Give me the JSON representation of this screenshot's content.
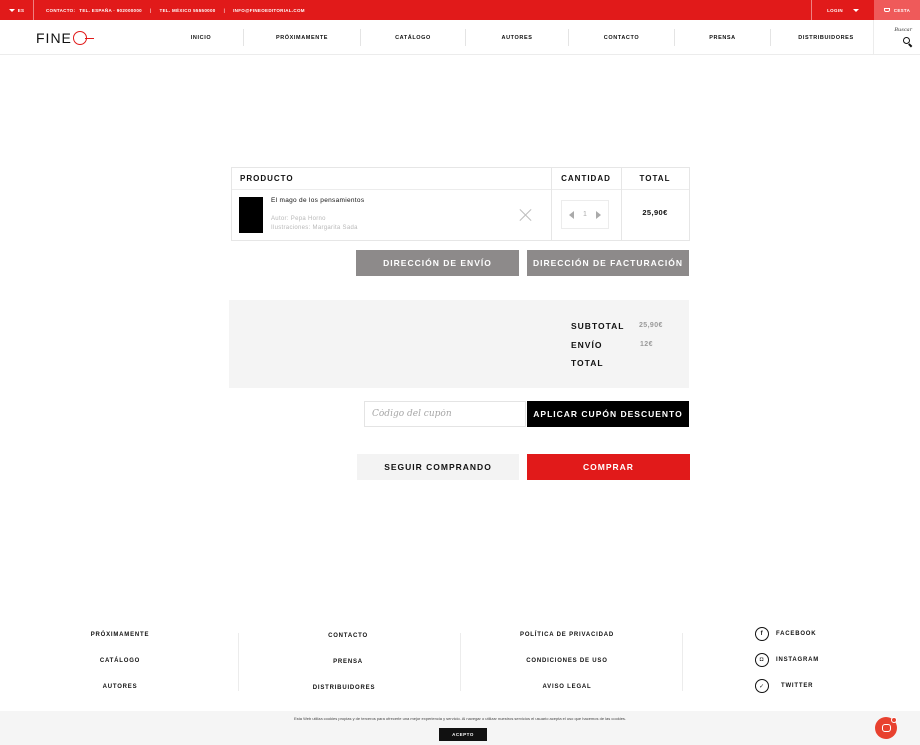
{
  "topbar": {
    "lang": "ES",
    "contact_label": "CONTACTO:",
    "phone_es": "TEL. ESPAÑA · 902000000",
    "phone_mx": "TEL. MÉXICO 55550000",
    "email": "INFO@FINEOEDITORIAL.COM",
    "login": "LOGIN",
    "cart": "CESTA"
  },
  "nav": {
    "logo": "FINE",
    "items": [
      "INICIO",
      "PRÓXIMAMENTE",
      "CATÁLOGO",
      "AUTORES",
      "CONTACTO",
      "PRENSA",
      "DISTRIBUIDORES"
    ],
    "search_label": "Buscar"
  },
  "cart": {
    "headers": {
      "product": "PRODUCTO",
      "quantity": "CANTIDAD",
      "total": "TOTAL"
    },
    "item": {
      "title": "El mago de los pensamientos",
      "author": "Autor: Pepa Horno",
      "illustrator": "Ilustraciones: Margarita Sada",
      "quantity": "1",
      "price": "25,90€"
    }
  },
  "buttons": {
    "shipping": "DIRECCIÓN DE ENVÍO",
    "billing": "DIRECCIÓN DE FACTURACIÓN",
    "apply_coupon": "APLICAR CUPÓN DESCUENTO",
    "continue": "SEGUIR COMPRANDO",
    "buy": "COMPRAR"
  },
  "totals": {
    "subtotal_label": "SUBTOTAL",
    "subtotal_value": "25,90€",
    "shipping_label": "ENVÍO",
    "shipping_value": "12€",
    "total_label": "TOTAL"
  },
  "coupon": {
    "placeholder": "Código del cupón"
  },
  "footer": {
    "col1": [
      "PRÓXIMAMENTE",
      "CATÁLOGO",
      "AUTORES"
    ],
    "col2": [
      "CONTACTO",
      "PRENSA",
      "DISTRIBUIDORES"
    ],
    "col3": [
      "POLÍTICA DE PRIVACIDAD",
      "CONDICIONES DE USO",
      "AVISO LEGAL"
    ],
    "social": [
      "FACEBOOK",
      "INSTAGRAM",
      "TWITTER"
    ]
  },
  "cookie": {
    "text": "Esta Web utiliza cookies propias y de terceros para ofrecerle una mejor experiencia y servicio. Al navegar o utilizar nuestros servicios el usuario acepta el uso que hacemos de las cookies.",
    "accept": "ACEPTO"
  },
  "colors": {
    "brand_red": "#e11a1a",
    "grey_button": "#8d8a8a"
  }
}
